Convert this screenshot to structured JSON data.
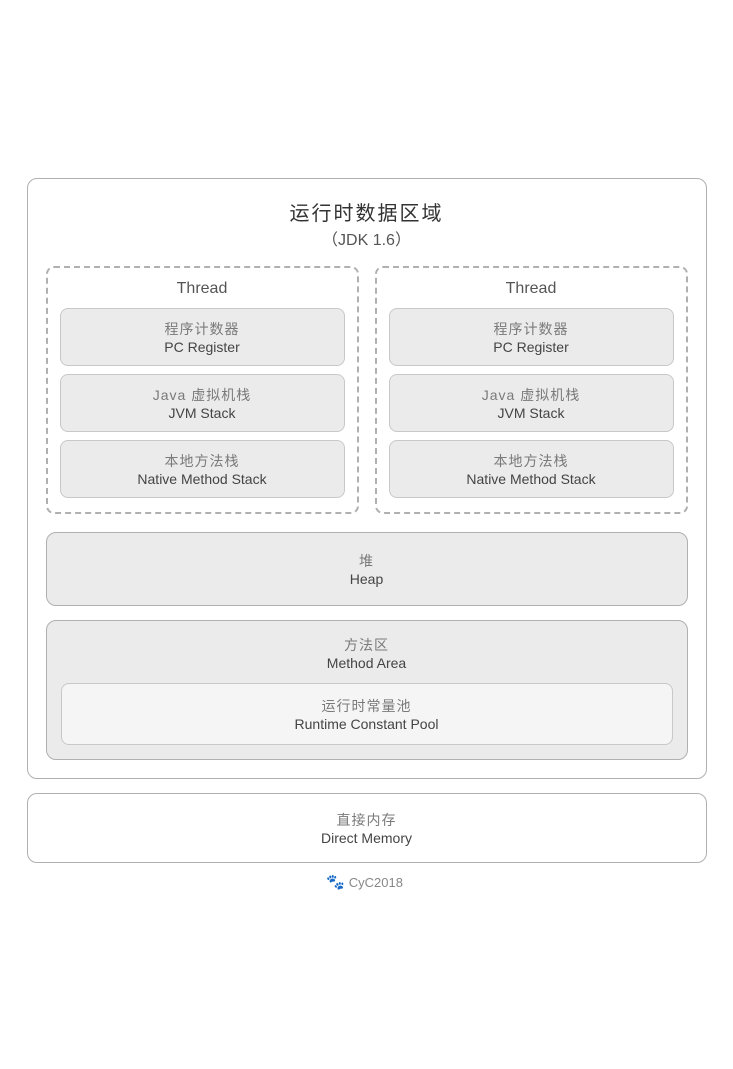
{
  "page": {
    "title_cn": "运行时数据区域",
    "title_sub": "（JDK 1.6）",
    "thread1": {
      "label": "Thread",
      "pc_cn": "程序计数器",
      "pc_en": "PC Register",
      "jvmstack_cn": "Java 虚拟机栈",
      "jvmstack_en": "JVM Stack",
      "native_cn": "本地方法栈",
      "native_en": "Native Method Stack"
    },
    "thread2": {
      "label": "Thread",
      "pc_cn": "程序计数器",
      "pc_en": "PC Register",
      "jvmstack_cn": "Java 虚拟机栈",
      "jvmstack_en": "JVM Stack",
      "native_cn": "本地方法栈",
      "native_en": "Native Method Stack"
    },
    "heap": {
      "cn": "堆",
      "en": "Heap"
    },
    "method_area": {
      "cn": "方法区",
      "en": "Method Area",
      "pool_cn": "运行时常量池",
      "pool_en": "Runtime Constant Pool"
    },
    "direct_memory": {
      "cn": "直接内存",
      "en": "Direct Memory"
    },
    "watermark": "CyC2018"
  }
}
